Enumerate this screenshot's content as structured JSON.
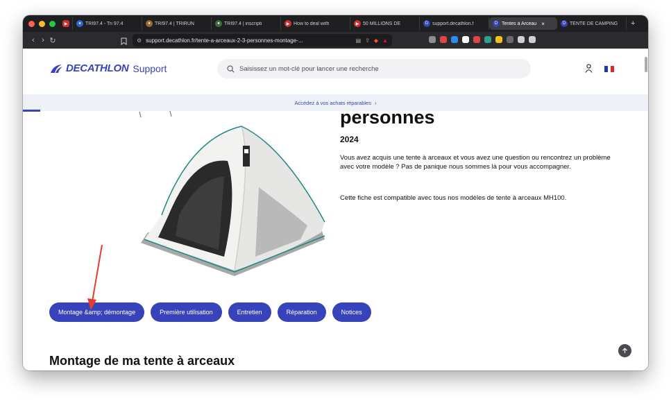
{
  "browser": {
    "tabs": [
      {
        "label": "TRI97.4 - Tri 97.4",
        "color": "#2f63d6",
        "glyph": "●"
      },
      {
        "label": "TRI97.4 | TRIRUN",
        "color": "#9a6b2f",
        "glyph": "●"
      },
      {
        "label": "TRI97.4 | inscripti",
        "color": "#3a6f3a",
        "glyph": "●"
      },
      {
        "label": "How to deal with",
        "color": "#d03030",
        "glyph": "▶"
      },
      {
        "label": "50 MILLIONS DE",
        "color": "#d03030",
        "glyph": "▶"
      },
      {
        "label": "support.decathlon.f",
        "color": "#3643ba",
        "glyph": "D"
      },
      {
        "label": "Tentes à Arceau",
        "color": "#3643ba",
        "glyph": "D",
        "active": true
      },
      {
        "label": "TENTE DE CAMPING",
        "color": "#3643ba",
        "glyph": "D"
      }
    ],
    "pinned_icon": "youtube-icon",
    "close_tab": "×",
    "new_tab": "+",
    "url": "support.decathlon.fr/tente-a-arceaux-2-3-personnes-montage-...",
    "nav": {
      "back": "‹",
      "forward": "›",
      "reload": "↻"
    },
    "extension_colors": [
      "#8e8e8e",
      "#e04545",
      "#2d8cf0",
      "#ffffff",
      "#e04545",
      "#2aa38a",
      "#f0c21a",
      "#6a6a6a",
      "#cfcfcf",
      "#cfcfcf"
    ]
  },
  "site": {
    "brand": "DECATHLON",
    "sub": "Support",
    "search_placeholder": "Saisissez un mot-clé pour lancer une recherche",
    "banner": "Accédez à vos achats réparables",
    "banner_chevron": "›",
    "flag_colors": [
      "#1c3ba8",
      "#ffffff",
      "#e0262c"
    ],
    "accent": "#3643ba"
  },
  "product": {
    "title": "personnes",
    "year": "2024",
    "description": "Vous avez acquis une tente à arceaux et vous avez une question ou rencontrez un problème avec votre modèle ? Pas de panique nous sommes là pour vous accompagner.",
    "compat": "Cette fiche est compatible avec tous nos modèles de tente à arceaux MH100."
  },
  "pills": [
    "Montage &amp; démontage",
    "Première utilisation",
    "Entretien",
    "Réparation",
    "Notices"
  ],
  "section_title": "Montage de ma tente à arceaux"
}
